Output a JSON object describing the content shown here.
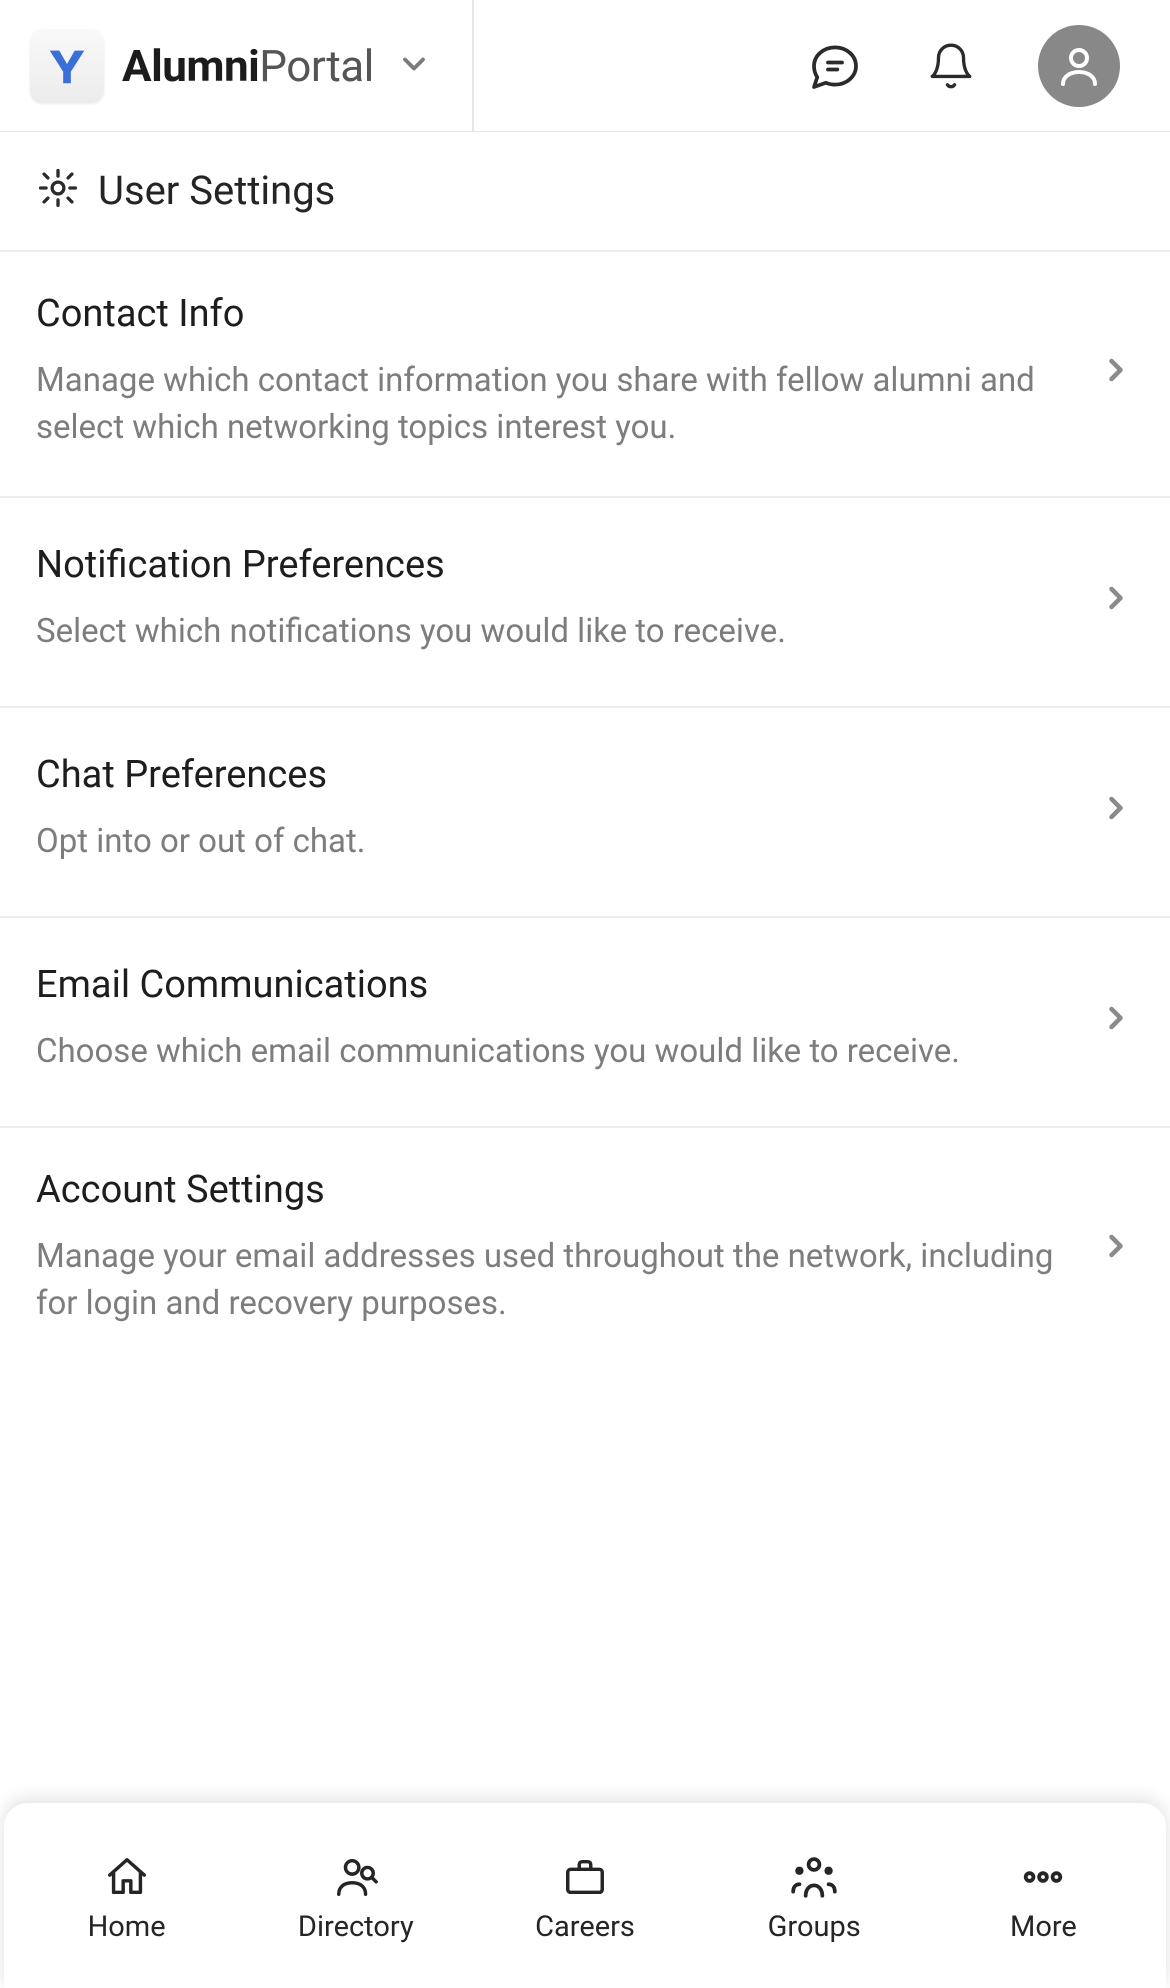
{
  "header": {
    "brand_bold": "Alumni",
    "brand_light": "Portal"
  },
  "page": {
    "title": "User Settings"
  },
  "settings": [
    {
      "id": "contact-info",
      "title": "Contact Info",
      "description": "Manage which contact information you share with fellow alumni and select which networking topics interest you."
    },
    {
      "id": "notification-preferences",
      "title": "Notification Preferences",
      "description": "Select which notifications you would like to receive."
    },
    {
      "id": "chat-preferences",
      "title": "Chat Preferences",
      "description": "Opt into or out of chat."
    },
    {
      "id": "email-communications",
      "title": "Email Communications",
      "description": "Choose which email communications you would like to receive."
    },
    {
      "id": "account-settings",
      "title": "Account Settings",
      "description": "Manage your email addresses used throughout the network, including for login and recovery purposes."
    }
  ],
  "nav": [
    {
      "id": "home",
      "label": "Home",
      "icon": "home-icon"
    },
    {
      "id": "directory",
      "label": "Directory",
      "icon": "directory-icon"
    },
    {
      "id": "careers",
      "label": "Careers",
      "icon": "briefcase-icon"
    },
    {
      "id": "groups",
      "label": "Groups",
      "icon": "groups-icon"
    },
    {
      "id": "more",
      "label": "More",
      "icon": "more-icon"
    }
  ]
}
